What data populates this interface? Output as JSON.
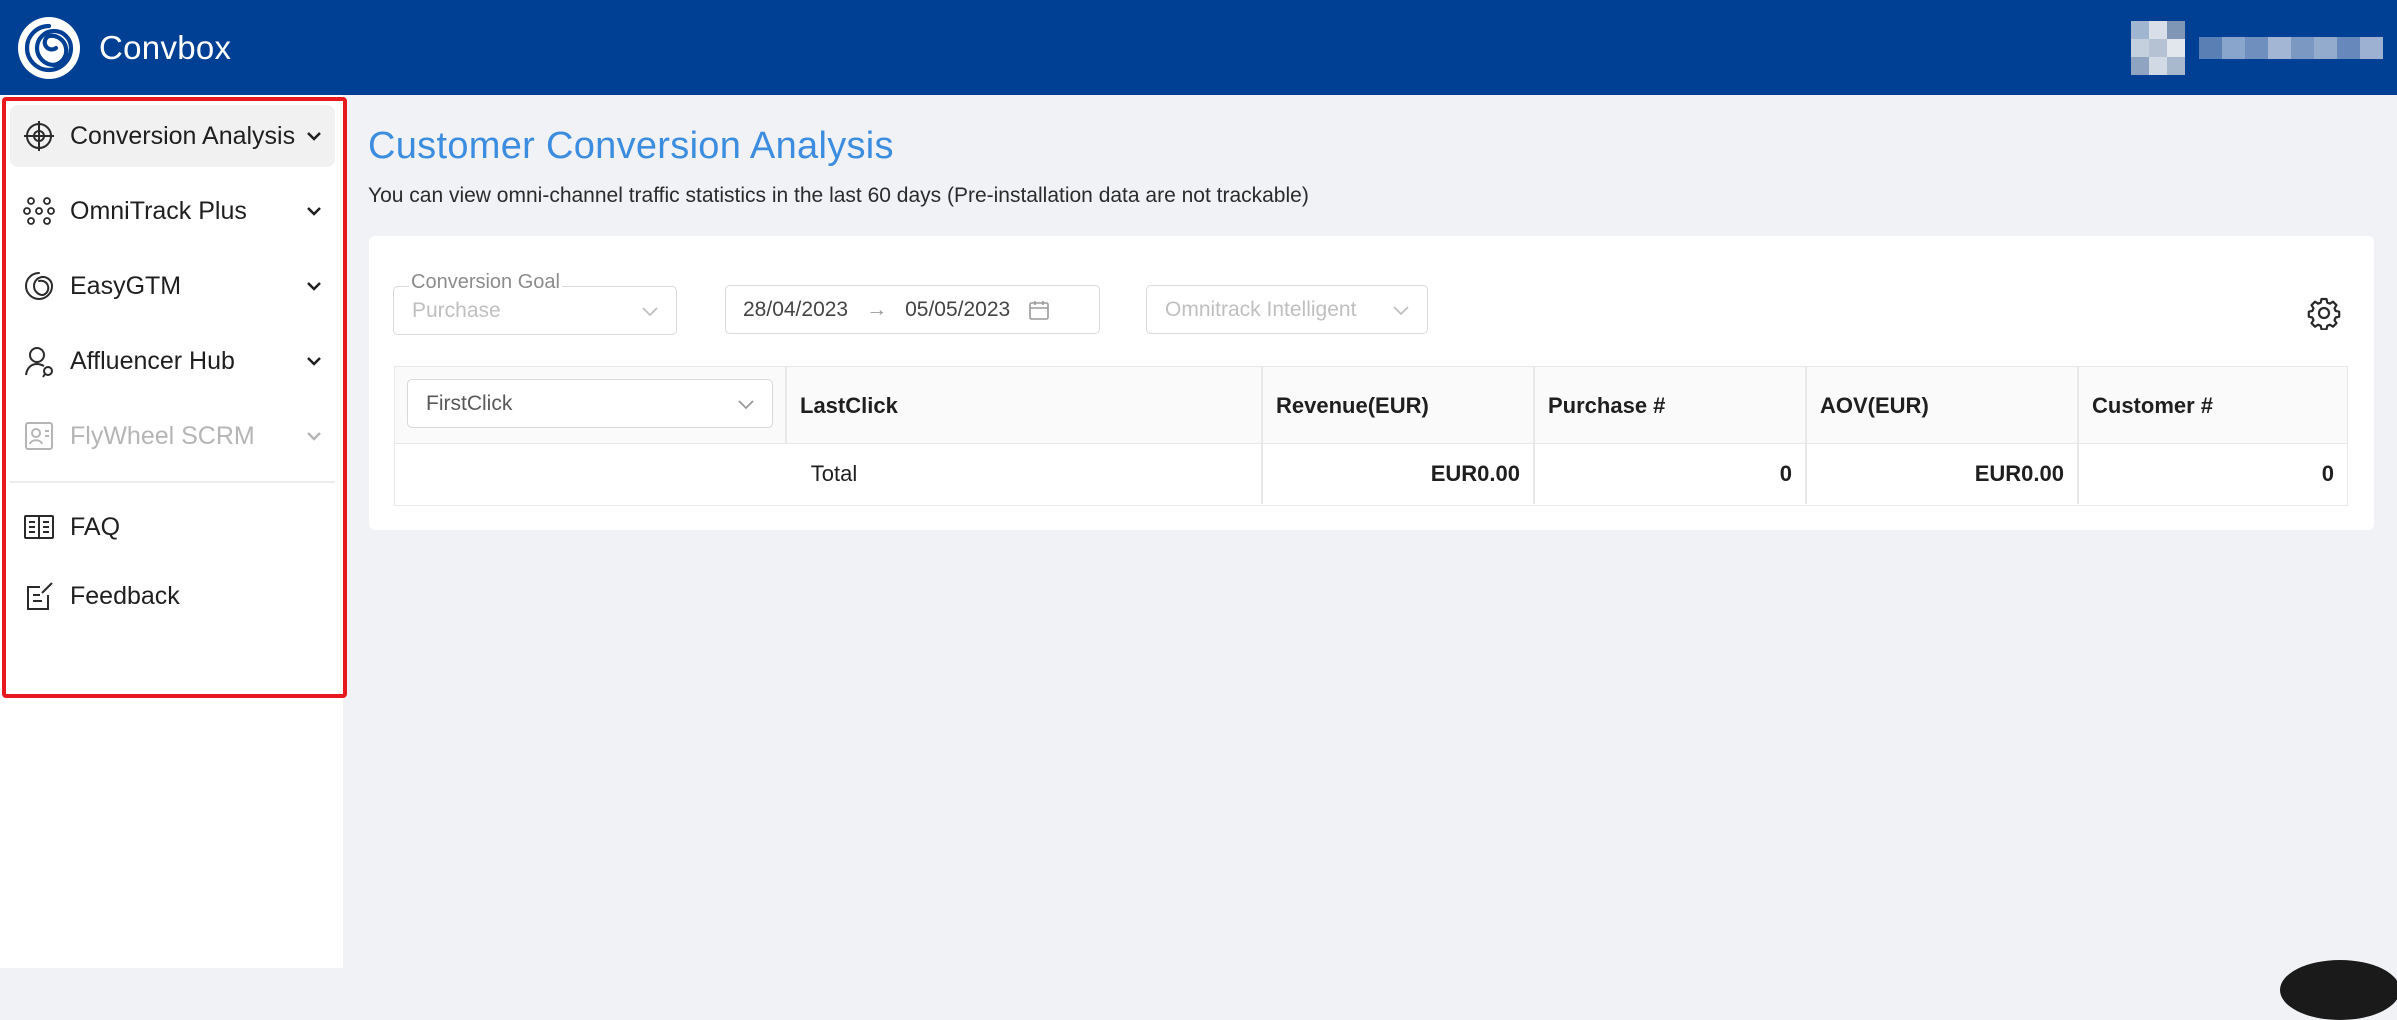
{
  "app": {
    "brand": "Convbox",
    "brand_color": "#004094"
  },
  "sidebar": {
    "highlight_color": "#e8191e",
    "items": [
      {
        "label": "Conversion Analysis",
        "icon": "target-icon",
        "active": true,
        "disabled": false
      },
      {
        "label": "OmniTrack Plus",
        "icon": "nodes-icon",
        "active": false,
        "disabled": false
      },
      {
        "label": "EasyGTM",
        "icon": "spiral-icon",
        "active": false,
        "disabled": false
      },
      {
        "label": "Affluencer Hub",
        "icon": "influencer-icon",
        "active": false,
        "disabled": false
      },
      {
        "label": "FlyWheel SCRM",
        "icon": "contact-card-icon",
        "active": false,
        "disabled": true
      }
    ],
    "links": [
      {
        "label": "FAQ",
        "icon": "book-icon"
      },
      {
        "label": "Feedback",
        "icon": "feedback-icon"
      }
    ]
  },
  "main": {
    "title": "Customer Conversion Analysis",
    "description": "You can view omni-channel traffic statistics in the last 60 days (Pre-installation data are not trackable)",
    "filters": {
      "conversion_goal_label": "Conversion Goal",
      "conversion_goal_value": "Purchase",
      "date_start": "28/04/2023",
      "date_arrow": "→",
      "date_end": "05/05/2023",
      "attribution_model": "Omnitrack Intelligent"
    },
    "table": {
      "first_column_select": "FirstClick",
      "headers": [
        "LastClick",
        "Revenue(EUR)",
        "Purchase #",
        "AOV(EUR)",
        "Customer #"
      ],
      "total_row": {
        "label": "Total",
        "revenue": "EUR0.00",
        "purchases": "0",
        "aov": "EUR0.00",
        "customers": "0"
      }
    }
  }
}
